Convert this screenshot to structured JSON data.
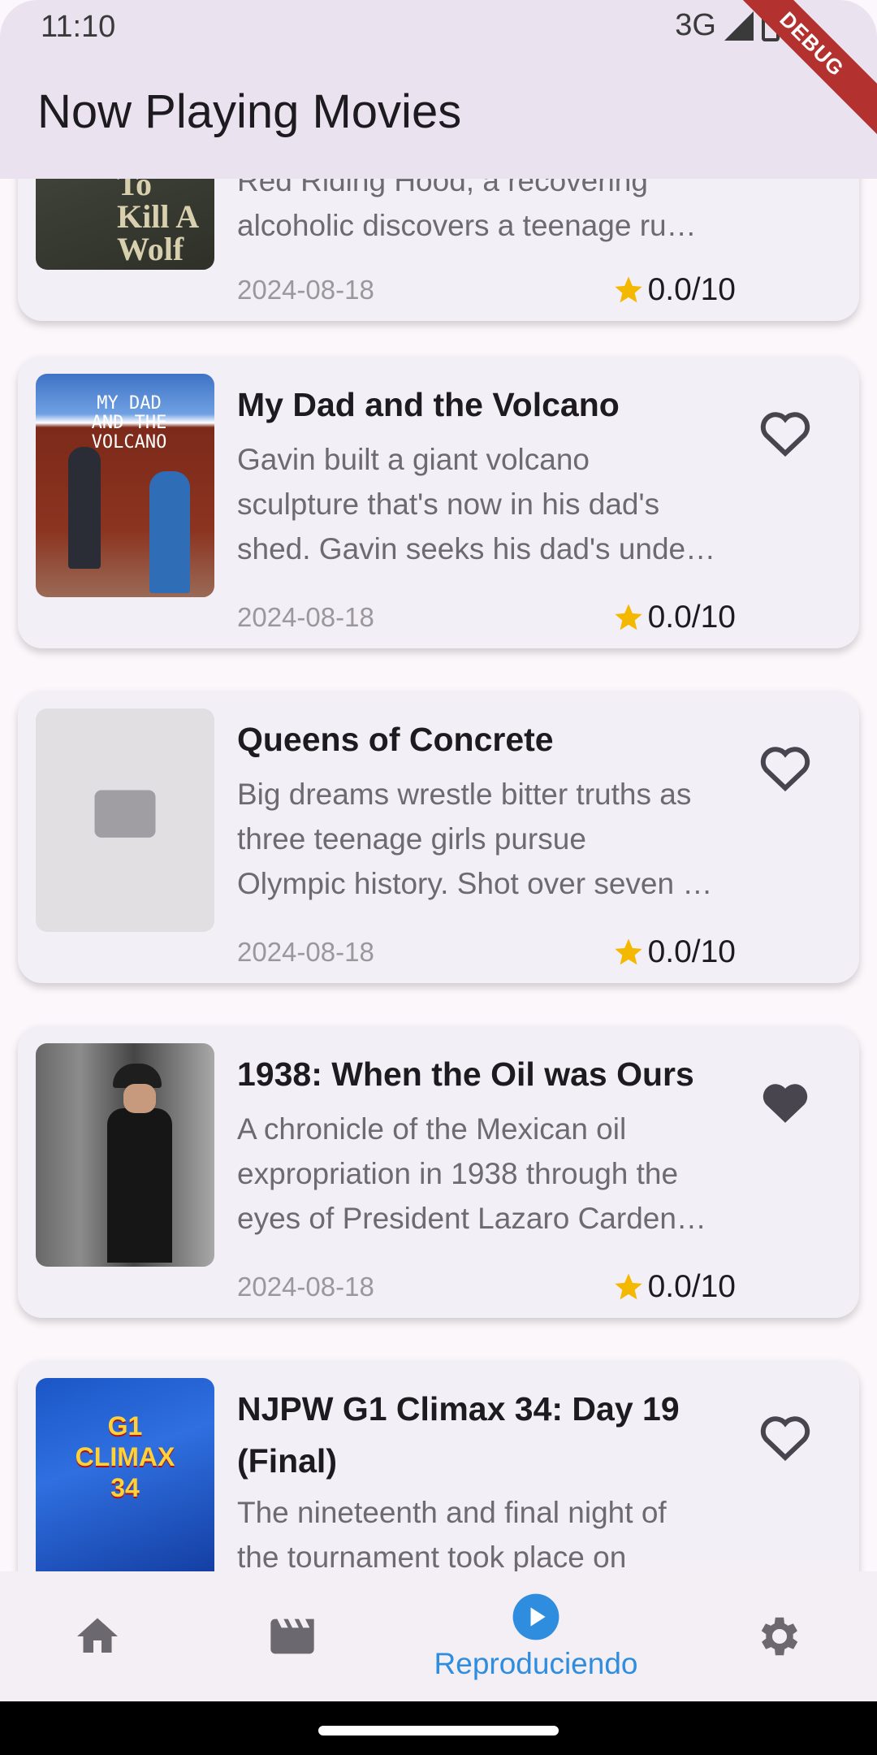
{
  "status_bar": {
    "time": "11:10",
    "network": "3G"
  },
  "debug_banner": "DEBUG",
  "app_bar": {
    "title": "Now Playing Movies"
  },
  "movies": [
    {
      "poster_text": "To Kill A Wolf",
      "desc_lines": [
        "Red Riding Hood, a recovering",
        "alcoholic discovers a teenage ru…"
      ],
      "date": "2024-08-18",
      "rating": "0.0/10"
    },
    {
      "title": "My Dad and the Volcano",
      "poster_text": "MY DAD AND THE VOLCANO",
      "desc_lines": [
        "Gavin built a giant volcano",
        "sculpture that's now in his dad's",
        "shed. Gavin seeks his dad's unde…"
      ],
      "date": "2024-08-18",
      "rating": "0.0/10",
      "favorite": false
    },
    {
      "title": "Queens of Concrete",
      "desc_lines": [
        "Big dreams wrestle bitter truths as",
        "three teenage girls pursue",
        "Olympic history. Shot over seven …"
      ],
      "date": "2024-08-18",
      "rating": "0.0/10",
      "favorite": false
    },
    {
      "title": "1938: When the Oil was Ours",
      "desc_lines": [
        "A chronicle of the Mexican oil",
        "expropriation in 1938 through the",
        "eyes of President Lazaro Carden…"
      ],
      "date": "2024-08-18",
      "rating": "0.0/10",
      "favorite": true
    },
    {
      "title_lines": [
        "NJPW G1 Climax 34: Day 19",
        "(Final)"
      ],
      "poster_text": "G1 CLIMAX 34",
      "desc_lines": [
        "The nineteenth and final night of",
        "the tournament took place on"
      ],
      "favorite": false
    }
  ],
  "bottom_nav": {
    "items": [
      {
        "icon": "home-icon",
        "label": ""
      },
      {
        "icon": "clapperboard-icon",
        "label": ""
      },
      {
        "icon": "play-circle-icon",
        "label": "Reproduciendo"
      },
      {
        "icon": "gear-icon",
        "label": ""
      }
    ],
    "active_index": 2
  },
  "colors": {
    "accent": "#2e8dde",
    "star": "#f5b800",
    "heart": "#49454f",
    "appbar": "#ebe2f0"
  }
}
